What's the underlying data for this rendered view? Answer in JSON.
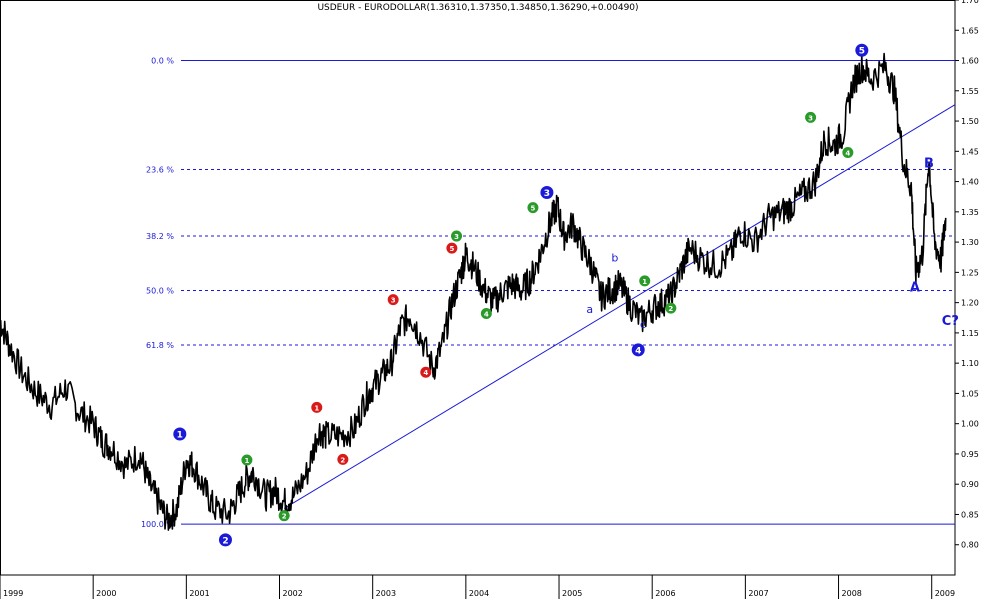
{
  "chart_data": {
    "type": "line",
    "title": "USDEUR - EURODOLLAR(1.36310,1.37350,1.34850,1.36290,+0.00490)",
    "ylim": [
      0.75,
      1.7
    ],
    "xlim": [
      1999.0,
      2009.25
    ],
    "x_ticks": [
      {
        "label": "1999",
        "value": 1999.0
      },
      {
        "label": "2000",
        "value": 2000.0
      },
      {
        "label": "2001",
        "value": 2001.0
      },
      {
        "label": "2002",
        "value": 2002.0
      },
      {
        "label": "2003",
        "value": 2003.0
      },
      {
        "label": "2004",
        "value": 2004.0
      },
      {
        "label": "2005",
        "value": 2005.0
      },
      {
        "label": "2006",
        "value": 2006.0
      },
      {
        "label": "2007",
        "value": 2007.0
      },
      {
        "label": "2008",
        "value": 2008.0
      },
      {
        "label": "2009",
        "value": 2009.0
      }
    ],
    "y_ticks": [
      "0.80",
      "0.85",
      "0.90",
      "0.95",
      "1.00",
      "1.05",
      "1.10",
      "1.15",
      "1.20",
      "1.25",
      "1.30",
      "1.35",
      "1.40",
      "1.45",
      "1.50",
      "1.55",
      "1.60",
      "1.65",
      "1.70"
    ],
    "grid": false,
    "series": [
      {
        "color": "#000000",
        "points": [
          [
            1999.0,
            1.17
          ],
          [
            1999.1,
            1.13
          ],
          [
            1999.25,
            1.08
          ],
          [
            1999.4,
            1.05
          ],
          [
            1999.55,
            1.03
          ],
          [
            1999.7,
            1.06
          ],
          [
            1999.85,
            1.02
          ],
          [
            2000.0,
            1.0
          ],
          [
            2000.1,
            0.97
          ],
          [
            2000.2,
            0.96
          ],
          [
            2000.35,
            0.93
          ],
          [
            2000.5,
            0.95
          ],
          [
            2000.6,
            0.9
          ],
          [
            2000.7,
            0.87
          ],
          [
            2000.8,
            0.84
          ],
          [
            2000.9,
            0.86
          ],
          [
            2001.0,
            0.94
          ],
          [
            2001.08,
            0.93
          ],
          [
            2001.2,
            0.89
          ],
          [
            2001.3,
            0.86
          ],
          [
            2001.45,
            0.85
          ],
          [
            2001.55,
            0.88
          ],
          [
            2001.65,
            0.91
          ],
          [
            2001.72,
            0.92
          ],
          [
            2001.85,
            0.88
          ],
          [
            2001.95,
            0.89
          ],
          [
            2002.05,
            0.87
          ],
          [
            2002.15,
            0.88
          ],
          [
            2002.3,
            0.92
          ],
          [
            2002.42,
            0.99
          ],
          [
            2002.5,
            0.98
          ],
          [
            2002.65,
            0.98
          ],
          [
            2002.8,
            0.99
          ],
          [
            2002.92,
            1.04
          ],
          [
            2003.0,
            1.06
          ],
          [
            2003.1,
            1.08
          ],
          [
            2003.2,
            1.1
          ],
          [
            2003.3,
            1.16
          ],
          [
            2003.4,
            1.18
          ],
          [
            2003.5,
            1.15
          ],
          [
            2003.65,
            1.09
          ],
          [
            2003.75,
            1.13
          ],
          [
            2003.85,
            1.2
          ],
          [
            2003.95,
            1.25
          ],
          [
            2004.0,
            1.28
          ],
          [
            2004.08,
            1.26
          ],
          [
            2004.2,
            1.22
          ],
          [
            2004.3,
            1.2
          ],
          [
            2004.4,
            1.22
          ],
          [
            2004.5,
            1.23
          ],
          [
            2004.6,
            1.22
          ],
          [
            2004.7,
            1.24
          ],
          [
            2004.8,
            1.28
          ],
          [
            2004.9,
            1.33
          ],
          [
            2004.98,
            1.36
          ],
          [
            2005.05,
            1.31
          ],
          [
            2005.15,
            1.33
          ],
          [
            2005.25,
            1.29
          ],
          [
            2005.35,
            1.26
          ],
          [
            2005.45,
            1.21
          ],
          [
            2005.55,
            1.22
          ],
          [
            2005.65,
            1.23
          ],
          [
            2005.75,
            1.2
          ],
          [
            2005.88,
            1.17
          ],
          [
            2006.0,
            1.19
          ],
          [
            2006.1,
            1.2
          ],
          [
            2006.2,
            1.21
          ],
          [
            2006.3,
            1.25
          ],
          [
            2006.4,
            1.29
          ],
          [
            2006.55,
            1.27
          ],
          [
            2006.7,
            1.26
          ],
          [
            2006.85,
            1.28
          ],
          [
            2006.95,
            1.32
          ],
          [
            2007.1,
            1.3
          ],
          [
            2007.25,
            1.34
          ],
          [
            2007.4,
            1.35
          ],
          [
            2007.5,
            1.36
          ],
          [
            2007.62,
            1.38
          ],
          [
            2007.75,
            1.4
          ],
          [
            2007.85,
            1.47
          ],
          [
            2007.95,
            1.46
          ],
          [
            2008.05,
            1.48
          ],
          [
            2008.15,
            1.56
          ],
          [
            2008.25,
            1.59
          ],
          [
            2008.35,
            1.57
          ],
          [
            2008.5,
            1.59
          ],
          [
            2008.6,
            1.55
          ],
          [
            2008.7,
            1.43
          ],
          [
            2008.78,
            1.39
          ],
          [
            2008.83,
            1.25
          ],
          [
            2008.9,
            1.28
          ],
          [
            2008.97,
            1.44
          ],
          [
            2009.03,
            1.3
          ],
          [
            2009.1,
            1.27
          ],
          [
            2009.15,
            1.34
          ]
        ]
      }
    ],
    "fibonacci_levels": [
      {
        "label": "0.0 %",
        "value": 1.6,
        "style": "solid"
      },
      {
        "label": "23.6 %",
        "value": 1.42,
        "style": "dashed"
      },
      {
        "label": "38.2 %",
        "value": 1.31,
        "style": "dashed"
      },
      {
        "label": "50.0 %",
        "value": 1.22,
        "style": "dashed"
      },
      {
        "label": "61.8 %",
        "value": 1.13,
        "style": "dashed"
      },
      {
        "label": "100.0 %",
        "value": 0.834,
        "style": "solid"
      }
    ],
    "trendline": {
      "from": [
        2002.05,
        0.86
      ],
      "to": [
        2009.25,
        1.527
      ]
    },
    "annotations": [
      {
        "text": "1",
        "kind": "circle",
        "color": "#1a1ad8",
        "size": "big",
        "x": 2000.93,
        "y": 0.983
      },
      {
        "text": "2",
        "kind": "circle",
        "color": "#1a1ad8",
        "size": "big",
        "x": 2001.42,
        "y": 0.808
      },
      {
        "text": "3",
        "kind": "circle",
        "color": "#1a1ad8",
        "size": "big",
        "x": 2004.87,
        "y": 1.382
      },
      {
        "text": "4",
        "kind": "circle",
        "color": "#1a1ad8",
        "size": "big",
        "x": 2005.85,
        "y": 1.122
      },
      {
        "text": "5",
        "kind": "circle",
        "color": "#1a1ad8",
        "size": "big",
        "x": 2008.25,
        "y": 1.617
      },
      {
        "text": "1",
        "kind": "circle",
        "color": "#2a9a2a",
        "size": "small",
        "x": 2001.65,
        "y": 0.94
      },
      {
        "text": "2",
        "kind": "circle",
        "color": "#2a9a2a",
        "size": "small",
        "x": 2002.05,
        "y": 0.848
      },
      {
        "text": "1",
        "kind": "circle",
        "color": "#d81a1a",
        "size": "small",
        "x": 2002.4,
        "y": 1.027
      },
      {
        "text": "2",
        "kind": "circle",
        "color": "#d81a1a",
        "size": "small",
        "x": 2002.68,
        "y": 0.941
      },
      {
        "text": "3",
        "kind": "circle",
        "color": "#d81a1a",
        "size": "small",
        "x": 2003.22,
        "y": 1.205
      },
      {
        "text": "4",
        "kind": "circle",
        "color": "#d81a1a",
        "size": "small",
        "x": 2003.57,
        "y": 1.085
      },
      {
        "text": "5",
        "kind": "circle",
        "color": "#d81a1a",
        "size": "small",
        "x": 2003.85,
        "y": 1.29
      },
      {
        "text": "3",
        "kind": "circle",
        "color": "#2a9a2a",
        "size": "small",
        "x": 2003.9,
        "y": 1.31
      },
      {
        "text": "4",
        "kind": "circle",
        "color": "#2a9a2a",
        "size": "small",
        "x": 2004.22,
        "y": 1.182
      },
      {
        "text": "5",
        "kind": "circle",
        "color": "#2a9a2a",
        "size": "small",
        "x": 2004.72,
        "y": 1.357
      },
      {
        "text": "1",
        "kind": "circle",
        "color": "#2a9a2a",
        "size": "small",
        "x": 2005.92,
        "y": 1.236
      },
      {
        "text": "2",
        "kind": "circle",
        "color": "#2a9a2a",
        "size": "small",
        "x": 2006.2,
        "y": 1.191
      },
      {
        "text": "3",
        "kind": "circle",
        "color": "#2a9a2a",
        "size": "small",
        "x": 2007.7,
        "y": 1.506
      },
      {
        "text": "4",
        "kind": "circle",
        "color": "#2a9a2a",
        "size": "small",
        "x": 2008.1,
        "y": 1.448
      },
      {
        "text": "a",
        "kind": "text",
        "color": "#1a1ad8",
        "size": "small",
        "x": 2005.33,
        "y": 1.183
      },
      {
        "text": "b",
        "kind": "text",
        "color": "#1a1ad8",
        "size": "small",
        "x": 2005.6,
        "y": 1.268
      },
      {
        "text": "c",
        "kind": "text",
        "color": "#1a1ad8",
        "size": "small",
        "x": 2005.9,
        "y": 1.158
      },
      {
        "text": "A",
        "kind": "text",
        "color": "#1a1ad8",
        "size": "big",
        "x": 2008.82,
        "y": 1.218
      },
      {
        "text": "B",
        "kind": "text",
        "color": "#1a1ad8",
        "size": "big",
        "x": 2008.97,
        "y": 1.423
      },
      {
        "text": "C?",
        "kind": "text",
        "color": "#1a1ad8",
        "size": "big",
        "x": 2009.2,
        "y": 1.163
      }
    ]
  }
}
